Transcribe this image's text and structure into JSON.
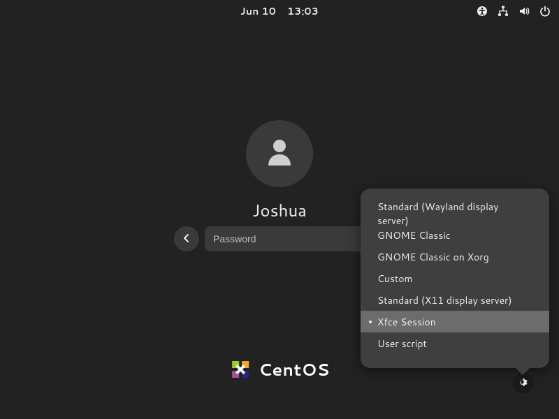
{
  "topbar": {
    "date": "Jun 10",
    "time": "13:03"
  },
  "login": {
    "username": "Joshua",
    "password_placeholder": "Password"
  },
  "distro": {
    "name": "CentOS"
  },
  "session_menu": {
    "items": [
      {
        "label": "Standard (Wayland display server)",
        "selected": false
      },
      {
        "label": "GNOME Classic",
        "selected": false
      },
      {
        "label": "GNOME Classic on Xorg",
        "selected": false
      },
      {
        "label": "Custom",
        "selected": false
      },
      {
        "label": "Standard (X11 display server)",
        "selected": false
      },
      {
        "label": "Xfce Session",
        "selected": true
      },
      {
        "label": "User script",
        "selected": false
      }
    ]
  },
  "icons": {
    "accessibility": "accessibility-icon",
    "network": "network-wired-icon",
    "volume": "volume-icon",
    "power": "power-icon",
    "avatar": "avatar-icon",
    "back": "chevron-left-icon",
    "eye_off": "eye-off-icon",
    "gear": "gear-icon"
  }
}
